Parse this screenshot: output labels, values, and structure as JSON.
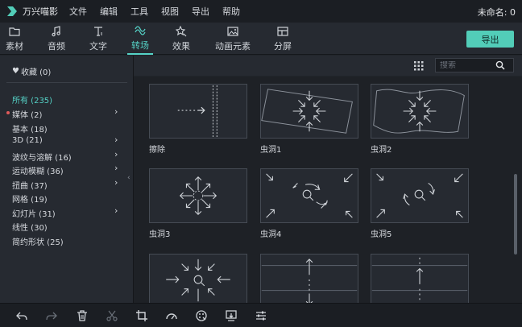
{
  "app": {
    "title": "万兴喵影",
    "document_name": "未命名: 0"
  },
  "menu": [
    "文件",
    "编辑",
    "工具",
    "视图",
    "导出",
    "帮助"
  ],
  "tabs": [
    {
      "label": "素材",
      "icon": "folder-icon"
    },
    {
      "label": "音频",
      "icon": "music-note-icon"
    },
    {
      "label": "文字",
      "icon": "text-icon"
    },
    {
      "label": "转场",
      "icon": "transition-icon",
      "active": true
    },
    {
      "label": "效果",
      "icon": "effects-icon"
    },
    {
      "label": "动画元素",
      "icon": "image-icon"
    },
    {
      "label": "分屏",
      "icon": "split-screen-icon"
    }
  ],
  "export_label": "导出",
  "search": {
    "placeholder": "搜索"
  },
  "sidebar": {
    "favorites": "收藏 (0)",
    "categories": [
      {
        "label": "所有 (235)",
        "active": true,
        "submenu": false
      },
      {
        "label": "媒体 (2)",
        "submenu": true,
        "marked": true
      },
      {
        "label": "基本 (18)",
        "submenu": false
      },
      {
        "label": "3D (21)",
        "submenu": true
      },
      {
        "label": "波纹与溶解 (16)",
        "submenu": true
      },
      {
        "label": "运动模糊 (36)",
        "submenu": true
      },
      {
        "label": "扭曲 (37)",
        "submenu": true
      },
      {
        "label": "网格 (19)",
        "submenu": false
      },
      {
        "label": "幻灯片 (31)",
        "submenu": true
      },
      {
        "label": "线性 (30)",
        "submenu": false
      },
      {
        "label": "简约形状 (25)",
        "submenu": false
      }
    ]
  },
  "transitions": [
    {
      "label": "擦除",
      "icon": "wipe-icon"
    },
    {
      "label": "虫洞1",
      "icon": "wormhole-icon"
    },
    {
      "label": "虫洞2",
      "icon": "wormhole-icon"
    },
    {
      "label": "虫洞3",
      "icon": "wormhole-icon"
    },
    {
      "label": "虫洞4",
      "icon": "wormhole-icon"
    },
    {
      "label": "虫洞5",
      "icon": "wormhole-icon"
    },
    {
      "label": "",
      "icon": "wormhole-icon"
    },
    {
      "label": "",
      "icon": "linear-icon"
    },
    {
      "label": "",
      "icon": "linear-icon"
    }
  ],
  "bottom_tools": [
    "undo-icon",
    "redo-icon",
    "delete-icon",
    "cut-icon",
    "crop-icon",
    "speed-icon",
    "color-icon",
    "export-frame-icon",
    "adjust-icon"
  ],
  "colors": {
    "accent": "#55d3c7",
    "export_button": "#52cdb8",
    "background": "#21252b"
  }
}
